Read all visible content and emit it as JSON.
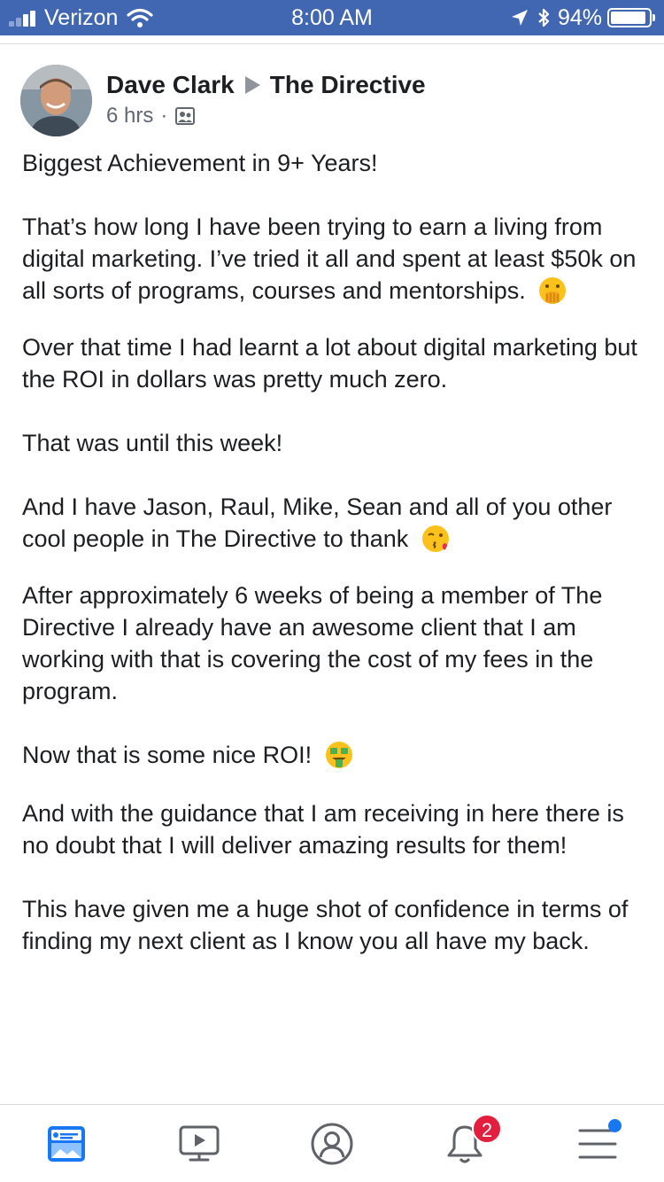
{
  "status_bar": {
    "carrier": "Verizon",
    "time": "8:00 AM",
    "battery": "94%",
    "battery_level": 0.94,
    "signal_icon": "signal-bars-icon",
    "wifi_icon": "wifi-icon",
    "location_icon": "location-arrow-icon",
    "bluetooth_icon": "bluetooth-icon"
  },
  "post": {
    "author": "Dave Clark",
    "group": "The Directive",
    "time_ago": "6 hrs",
    "separator": "·",
    "privacy_icon": "group-icon",
    "paragraphs": [
      "Biggest Achievement in 9+ Years!",
      "That’s how long I have been trying to earn a living from digital marketing. I’ve tried it all and spent at least $50k on all sorts of programs, courses and mentorships.",
      "Over that time I had learnt a lot about digital marketing but the ROI in dollars was pretty much zero.",
      "That was until this week!",
      "And I have Jason, Raul, Mike, Sean and all of you other cool people in The Directive to thank",
      "After approximately 6 weeks of being a member of The Directive I already have an awesome client that I am working with that is covering the cost of my fees in the program.",
      "Now that is some nice ROI!",
      "And with the guidance that I am receiving in here there is no doubt that I will deliver amazing results for them!",
      "This have given me a huge shot of confidence in terms of finding my next client as I know you all have my back."
    ],
    "emojis": {
      "p1": "hand-over-mouth-emoji",
      "p4": "face-blowing-kiss-emoji",
      "p6": "money-mouth-face-emoji"
    }
  },
  "tab_bar": {
    "tabs": [
      {
        "name": "news-feed",
        "icon": "news-feed-icon",
        "active": true
      },
      {
        "name": "watch",
        "icon": "video-play-icon",
        "active": false
      },
      {
        "name": "profile",
        "icon": "profile-icon",
        "active": false
      },
      {
        "name": "notifications",
        "icon": "bell-icon",
        "active": false,
        "badge": "2"
      },
      {
        "name": "menu",
        "icon": "hamburger-menu-icon",
        "active": false
      }
    ]
  },
  "colors": {
    "status_bar_bg": "#4267b2",
    "text": "#1c1e21",
    "meta_text": "#606770",
    "tab_icon": "#5f6368",
    "active_tab": "#1877f2",
    "badge": "#e41e3f"
  }
}
